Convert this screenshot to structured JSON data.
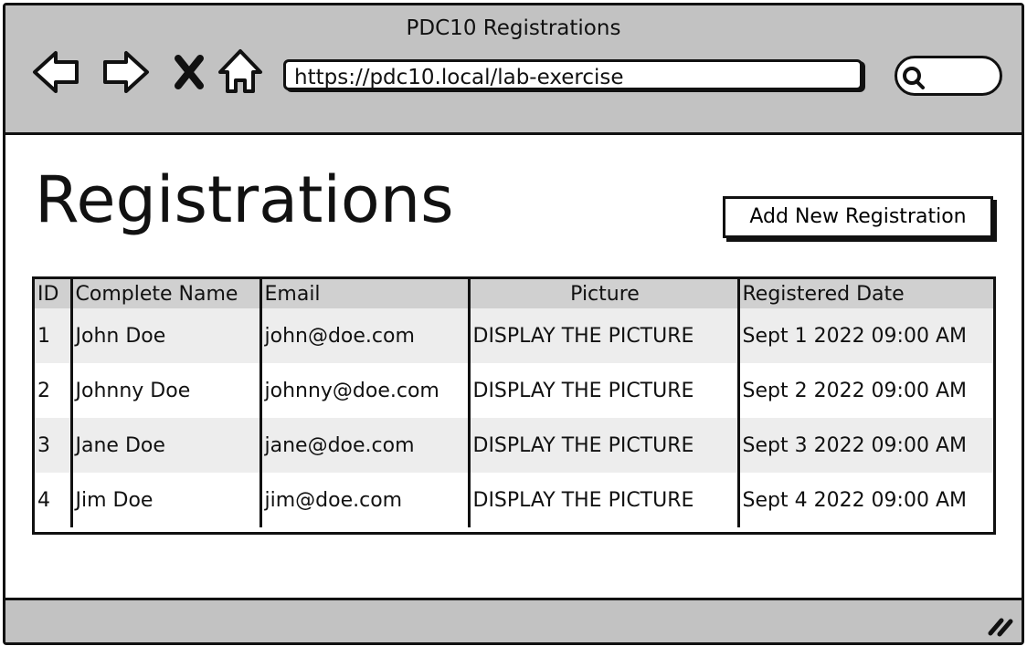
{
  "window": {
    "title": "PDC10 Registrations"
  },
  "nav": {
    "back_icon": "back-arrow-icon",
    "forward_icon": "forward-arrow-icon",
    "stop_icon": "close-icon",
    "home_icon": "home-icon"
  },
  "address_bar": {
    "value": "https://pdc10.local/lab-exercise"
  },
  "search": {
    "icon": "search-icon"
  },
  "page": {
    "title": "Registrations",
    "add_button_label": "Add New Registration"
  },
  "table": {
    "headers": [
      "ID",
      "Complete Name",
      "Email",
      "Picture",
      "Registered Date"
    ],
    "rows": [
      {
        "id": "1",
        "name": "John Doe",
        "email": "john@doe.com",
        "picture": "DISPLAY THE PICTURE",
        "date": "Sept 1 2022 09:00 AM"
      },
      {
        "id": "2",
        "name": "Johnny Doe",
        "email": "johnny@doe.com",
        "picture": "DISPLAY THE PICTURE",
        "date": "Sept 2 2022 09:00 AM"
      },
      {
        "id": "3",
        "name": "Jane Doe",
        "email": "jane@doe.com",
        "picture": "DISPLAY THE PICTURE",
        "date": "Sept 3 2022 09:00 AM"
      },
      {
        "id": "4",
        "name": "Jim Doe",
        "email": "jim@doe.com",
        "picture": "DISPLAY THE PICTURE",
        "date": "Sept 4 2022 09:00 AM"
      }
    ]
  },
  "colors": {
    "chrome": "#c2c2c2",
    "header_row": "#d0d0d0",
    "stripe": "#ededed",
    "ink": "#111111"
  }
}
